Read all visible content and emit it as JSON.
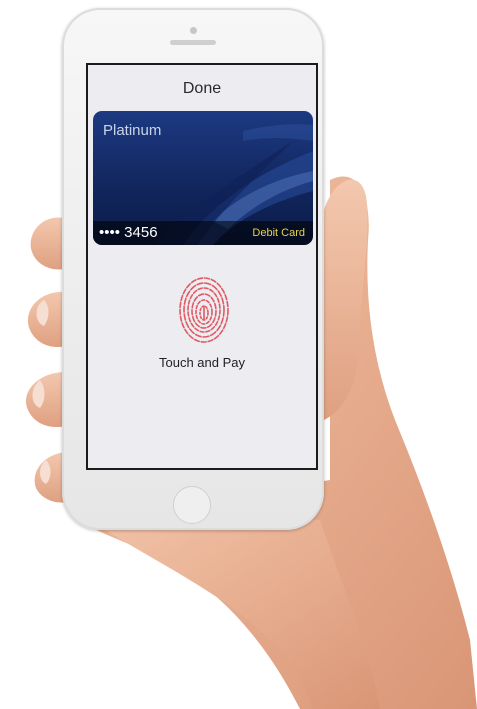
{
  "screen": {
    "header_label": "Done",
    "card": {
      "name": "Platinum",
      "number": "•••• 3456",
      "type_label": "Debit Card"
    },
    "prompt": "Touch and Pay"
  },
  "icons": {
    "fingerprint": "fingerprint-icon"
  },
  "colors": {
    "card_blue": "#142a65",
    "card_type_yellow": "#e8d34a",
    "fingerprint_red": "#e05a63",
    "screen_bg": "#ececf1"
  }
}
